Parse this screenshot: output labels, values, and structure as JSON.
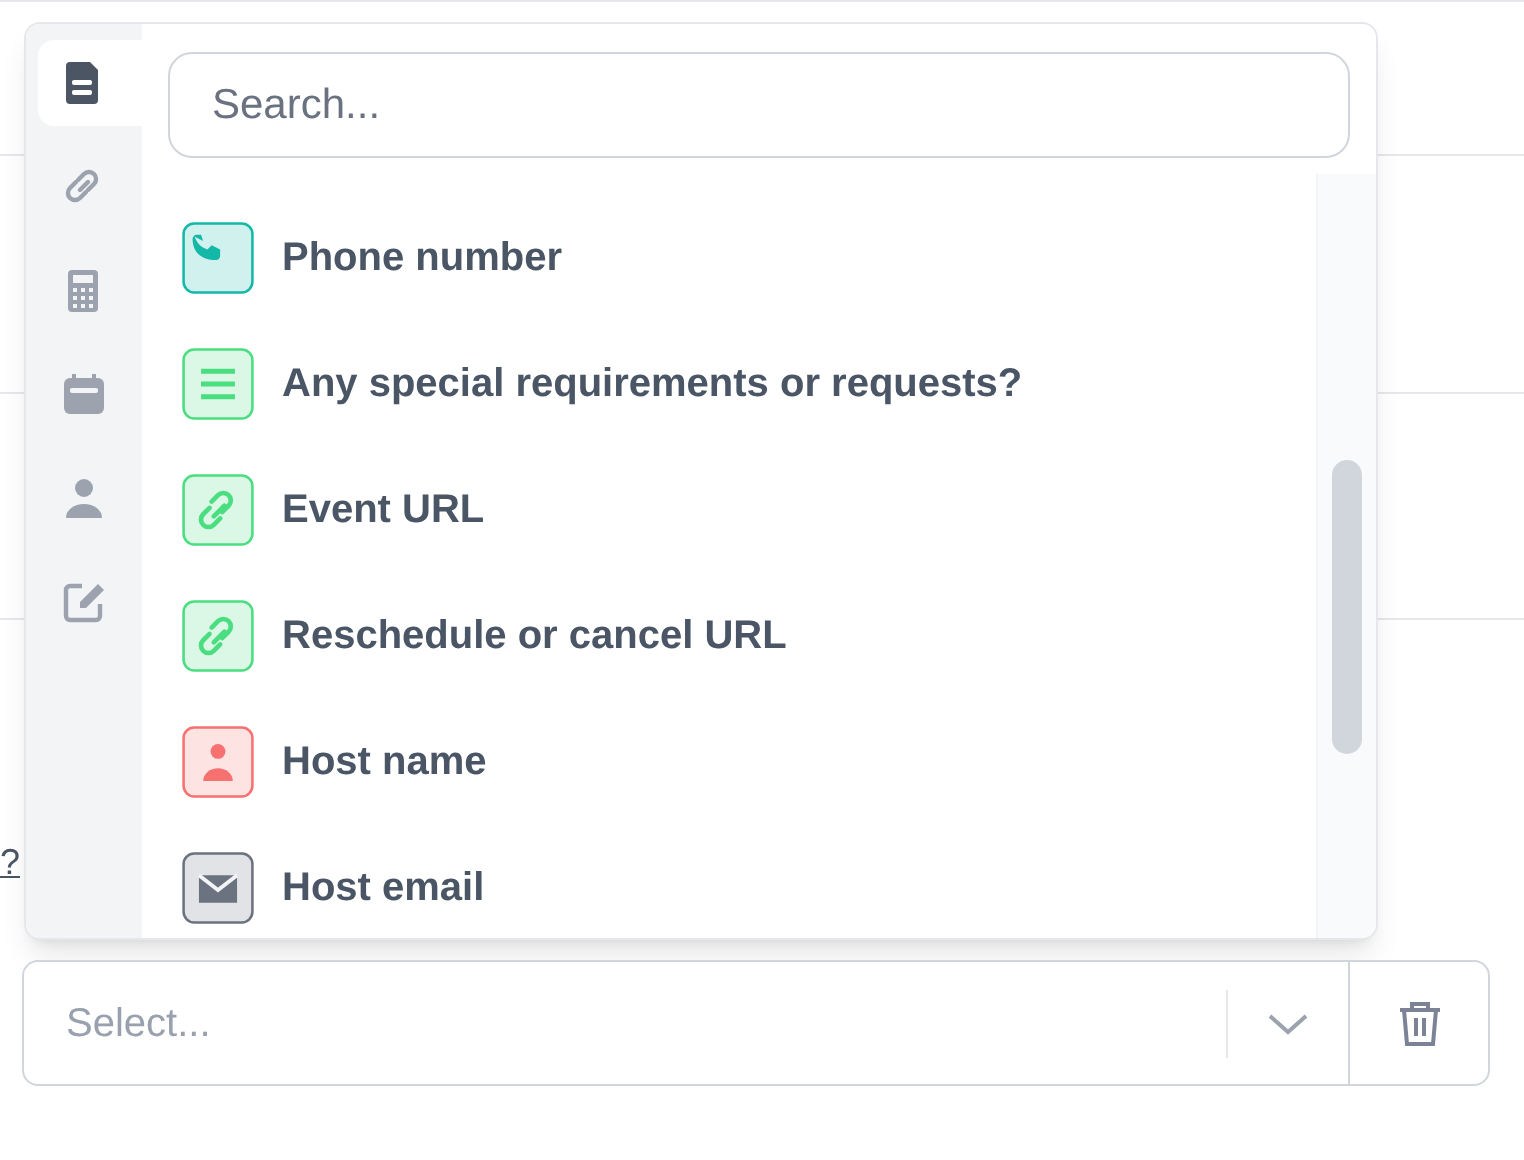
{
  "background": {
    "cut_text": "?"
  },
  "sidebar": {
    "tabs": [
      {
        "kind": "document",
        "selected": true
      },
      {
        "kind": "link",
        "selected": false
      },
      {
        "kind": "calculator",
        "selected": false
      },
      {
        "kind": "calendar",
        "selected": false
      },
      {
        "kind": "person",
        "selected": false
      },
      {
        "kind": "edit",
        "selected": false
      }
    ]
  },
  "search": {
    "placeholder": "Search..."
  },
  "items": [
    {
      "kind": "phone",
      "label": "Phone number",
      "color": "#14b8a6"
    },
    {
      "kind": "text",
      "label": "Any special requirements or requests?",
      "color": "#4ade80"
    },
    {
      "kind": "link",
      "label": "Event URL",
      "color": "#4ade80"
    },
    {
      "kind": "link",
      "label": "Reschedule or cancel URL",
      "color": "#4ade80"
    },
    {
      "kind": "person",
      "label": "Host name",
      "color": "#f87171"
    },
    {
      "kind": "email",
      "label": "Host email",
      "color": "#6b7280"
    }
  ],
  "select": {
    "placeholder": "Select..."
  }
}
